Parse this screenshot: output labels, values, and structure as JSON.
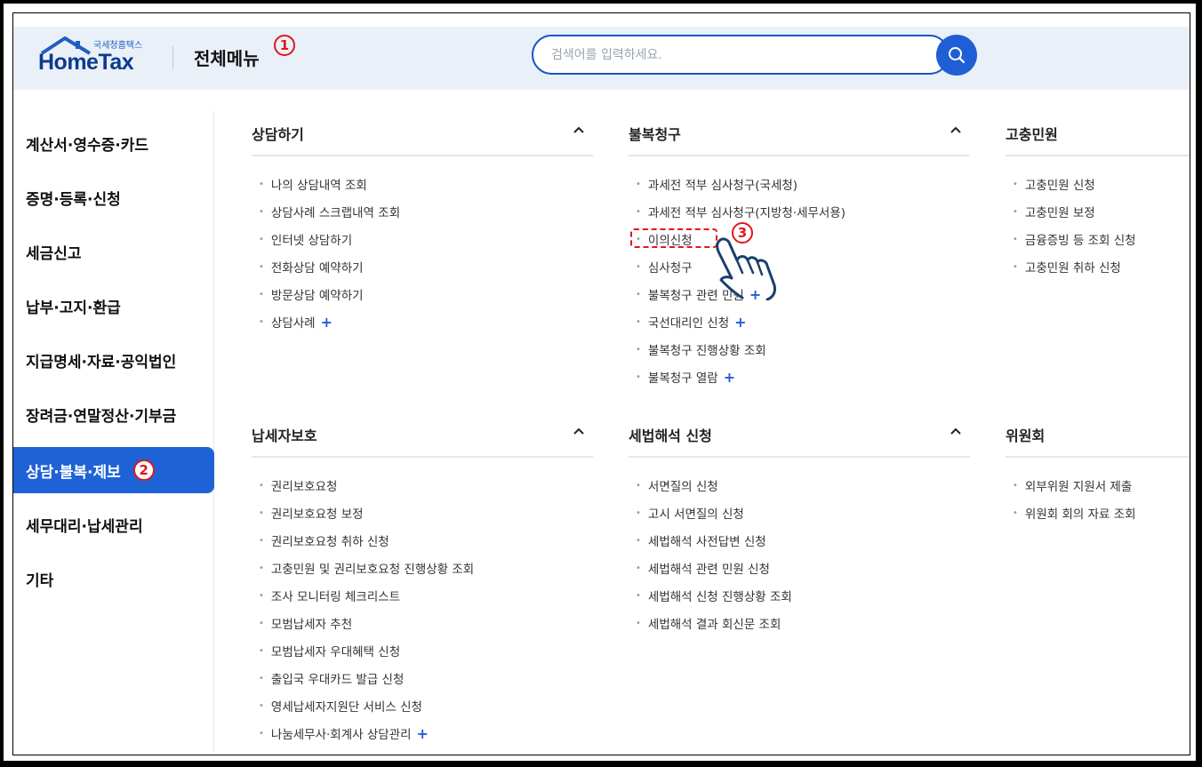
{
  "header": {
    "logo_small": "국세청홈택스",
    "logo_main": "HomeTax",
    "menu_title": "전체메뉴",
    "step1": "1",
    "search_placeholder": "검색어를 입력하세요."
  },
  "sidebar": {
    "items": [
      {
        "label": "계산서·영수증·카드"
      },
      {
        "label": "증명·등록·신청"
      },
      {
        "label": "세금신고"
      },
      {
        "label": "납부·고지·환급"
      },
      {
        "label": "지급명세·자료·공익법인"
      },
      {
        "label": "장려금·연말정산·기부금"
      },
      {
        "label": "상담·불복·제보",
        "active": true
      },
      {
        "label": "세무대리·납세관리"
      },
      {
        "label": "기타"
      }
    ],
    "step2": "2"
  },
  "sections": {
    "consult": {
      "title": "상담하기",
      "links": [
        "나의 상담내역 조회",
        "상담사례 스크랩내역 조회",
        "인터넷 상담하기",
        "전화상담 예약하기",
        "방문상담 예약하기",
        "상담사례"
      ]
    },
    "appeal": {
      "title": "불복청구",
      "links": [
        "과세전 적부 심사청구(국세청)",
        "과세전 적부 심사청구(지방청·세무서용)",
        "이의신청",
        "심사청구",
        "불복청구 관련 민원",
        "국선대리인 신청",
        "불복청구 진행상황 조회",
        "불복청구 열람"
      ],
      "step3": "3"
    },
    "grievance": {
      "title": "고충민원",
      "links": [
        "고충민원 신청",
        "고충민원 보정",
        "금융증빙 등 조회 신청",
        "고충민원 취하 신청"
      ]
    },
    "protect": {
      "title": "납세자보호",
      "links": [
        "권리보호요청",
        "권리보호요청 보정",
        "권리보호요청 취하 신청",
        "고충민원 및 권리보호요청 진행상황 조회",
        "조사 모니터링 체크리스트",
        "모범납세자 추천",
        "모범납세자 우대혜택 신청",
        "출입국 우대카드 발급 신청",
        "영세납세자지원단 서비스 신청",
        "나눔세무사·회계사 상담관리"
      ]
    },
    "interpret": {
      "title": "세법해석 신청",
      "links": [
        "서면질의 신청",
        "고시 서면질의 신청",
        "세법해석 사전답변 신청",
        "세법해석 관련 민원 신청",
        "세법해석 신청 진행상황 조회",
        "세법해석 결과 회신문 조회"
      ]
    },
    "committee": {
      "title": "위원회",
      "links": [
        "외부위원 지원서 제출",
        "위원회 회의 자료 조회"
      ]
    }
  },
  "colors": {
    "accent": "#1e63d6",
    "marker": "#e0161b",
    "header_bg": "#eaf0f8"
  }
}
